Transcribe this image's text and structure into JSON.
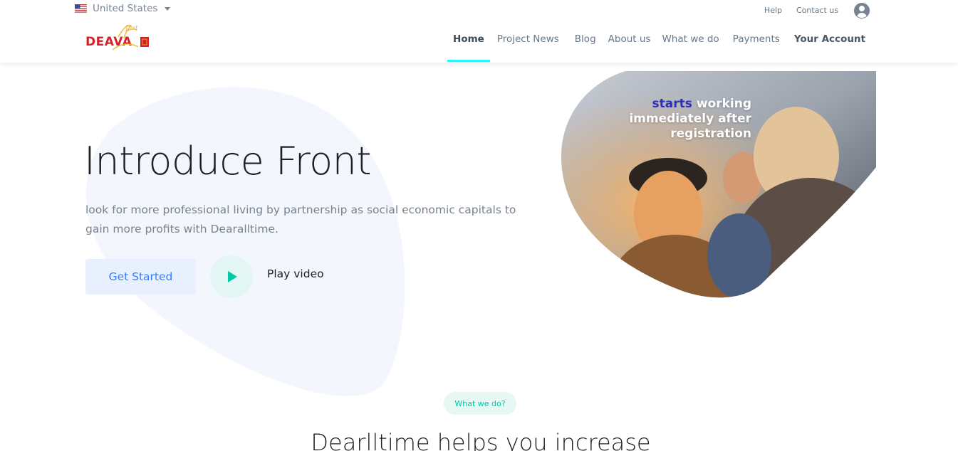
{
  "header": {
    "locale": {
      "label": "United States",
      "flag_icon": "us-flag-icon"
    },
    "top_links": {
      "help": "Help",
      "contact": "Contact us"
    },
    "logo_text": "DEAVA",
    "nav": [
      {
        "label": "Home",
        "active": true
      },
      {
        "label": "Project News"
      },
      {
        "label": "Blog"
      },
      {
        "label": "About us"
      },
      {
        "label": "What we do"
      },
      {
        "label": "Payments"
      },
      {
        "label": "Your Account"
      }
    ]
  },
  "hero": {
    "title": "Introduce Front",
    "description": "look for more professional living by partnership as social economic capitals to gain more profits with Dearalltime.",
    "get_started": "Get Started",
    "play_video": "Play video",
    "photo_caption_highlight": "starts",
    "photo_caption_rest": "working immediately after registration"
  },
  "section": {
    "badge": "What we do?",
    "title": "Dearlltime helps you increase"
  },
  "colors": {
    "accent": "#377dff",
    "teal": "#00c9a7",
    "nav_underline": "#2ef2ff",
    "blob": "#f3f6fd"
  }
}
